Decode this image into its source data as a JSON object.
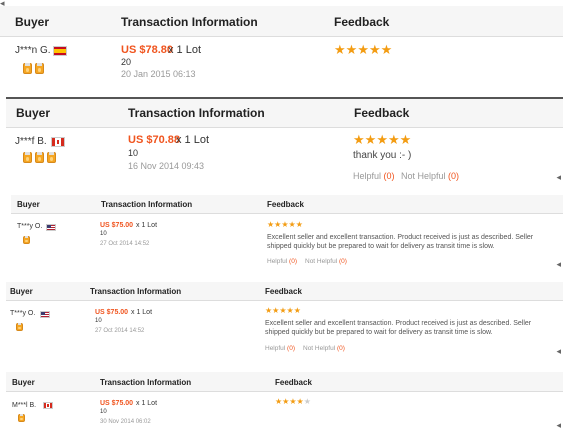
{
  "headers": {
    "buyer": "Buyer",
    "transaction": "Transaction Information",
    "feedback": "Feedback"
  },
  "reviews": [
    {
      "buyer": "J***n G.",
      "country_flag": "flag-spain",
      "medals": 2,
      "price": "US $78.80",
      "lot": "x 1 Lot",
      "quantity": "20",
      "date": "20 Jan 2015 06:13",
      "rating": 5,
      "comment": "",
      "helpful_label": "",
      "helpful_count": "",
      "not_helpful_label": "",
      "not_helpful_count": ""
    },
    {
      "buyer": "J***f B.",
      "country_flag": "flag-canada",
      "medals": 3,
      "price": "US $70.88",
      "lot": "x 1 Lot",
      "quantity": "10",
      "date": "16 Nov 2014 09:43",
      "rating": 5,
      "comment": "thank you :- )",
      "helpful_label": "Helpful",
      "helpful_count": "(0)",
      "not_helpful_label": "Not Helpful",
      "not_helpful_count": "(0)"
    },
    {
      "buyer": "T***y O.",
      "country_flag": "flag-usa",
      "medals": 1,
      "price": "US $75.00",
      "lot": "x 1 Lot",
      "quantity": "10",
      "date": "27 Oct 2014 14:52",
      "rating": 5,
      "comment_line1": "Excellent seller and excellent transaction. Product received is just as described. Seller",
      "comment_line2": "shipped quickly but be prepared to wait for delivery as transit time is slow.",
      "helpful_label": "Helpful",
      "helpful_count": "(0)",
      "not_helpful_label": "Not Helpful",
      "not_helpful_count": "(0)"
    },
    {
      "buyer": "T***y O.",
      "country_flag": "flag-usa",
      "medals": 1,
      "price": "US $75.00",
      "lot": "x 1 Lot",
      "quantity": "10",
      "date": "27 Oct 2014 14:52",
      "rating": 5,
      "comment_line1": "Excellent seller and excellent transaction. Product received is just as described. Seller",
      "comment_line2": "shipped quickly but be prepared to wait for delivery as transit time is slow.",
      "helpful_label": "Helpful",
      "helpful_count": "(0)",
      "not_helpful_label": "Not Helpful",
      "not_helpful_count": "(0)"
    },
    {
      "buyer": "M***l B.",
      "country_flag": "flag-canada",
      "medals": 1,
      "price": "US $75.00",
      "lot": "x 1 Lot",
      "quantity": "10",
      "date": "30 Nov 2014 06:02",
      "rating": 4,
      "comment": "",
      "helpful_label": "",
      "helpful_count": "",
      "not_helpful_label": "",
      "not_helpful_count": ""
    }
  ],
  "icons": {
    "star": "star-icon",
    "medal": "medal-icon",
    "arrow": "left-arrow-icon"
  },
  "colors": {
    "price": "#f0541e",
    "stars": "#f39c12",
    "medal": "#f5a623",
    "muted": "#999999"
  }
}
